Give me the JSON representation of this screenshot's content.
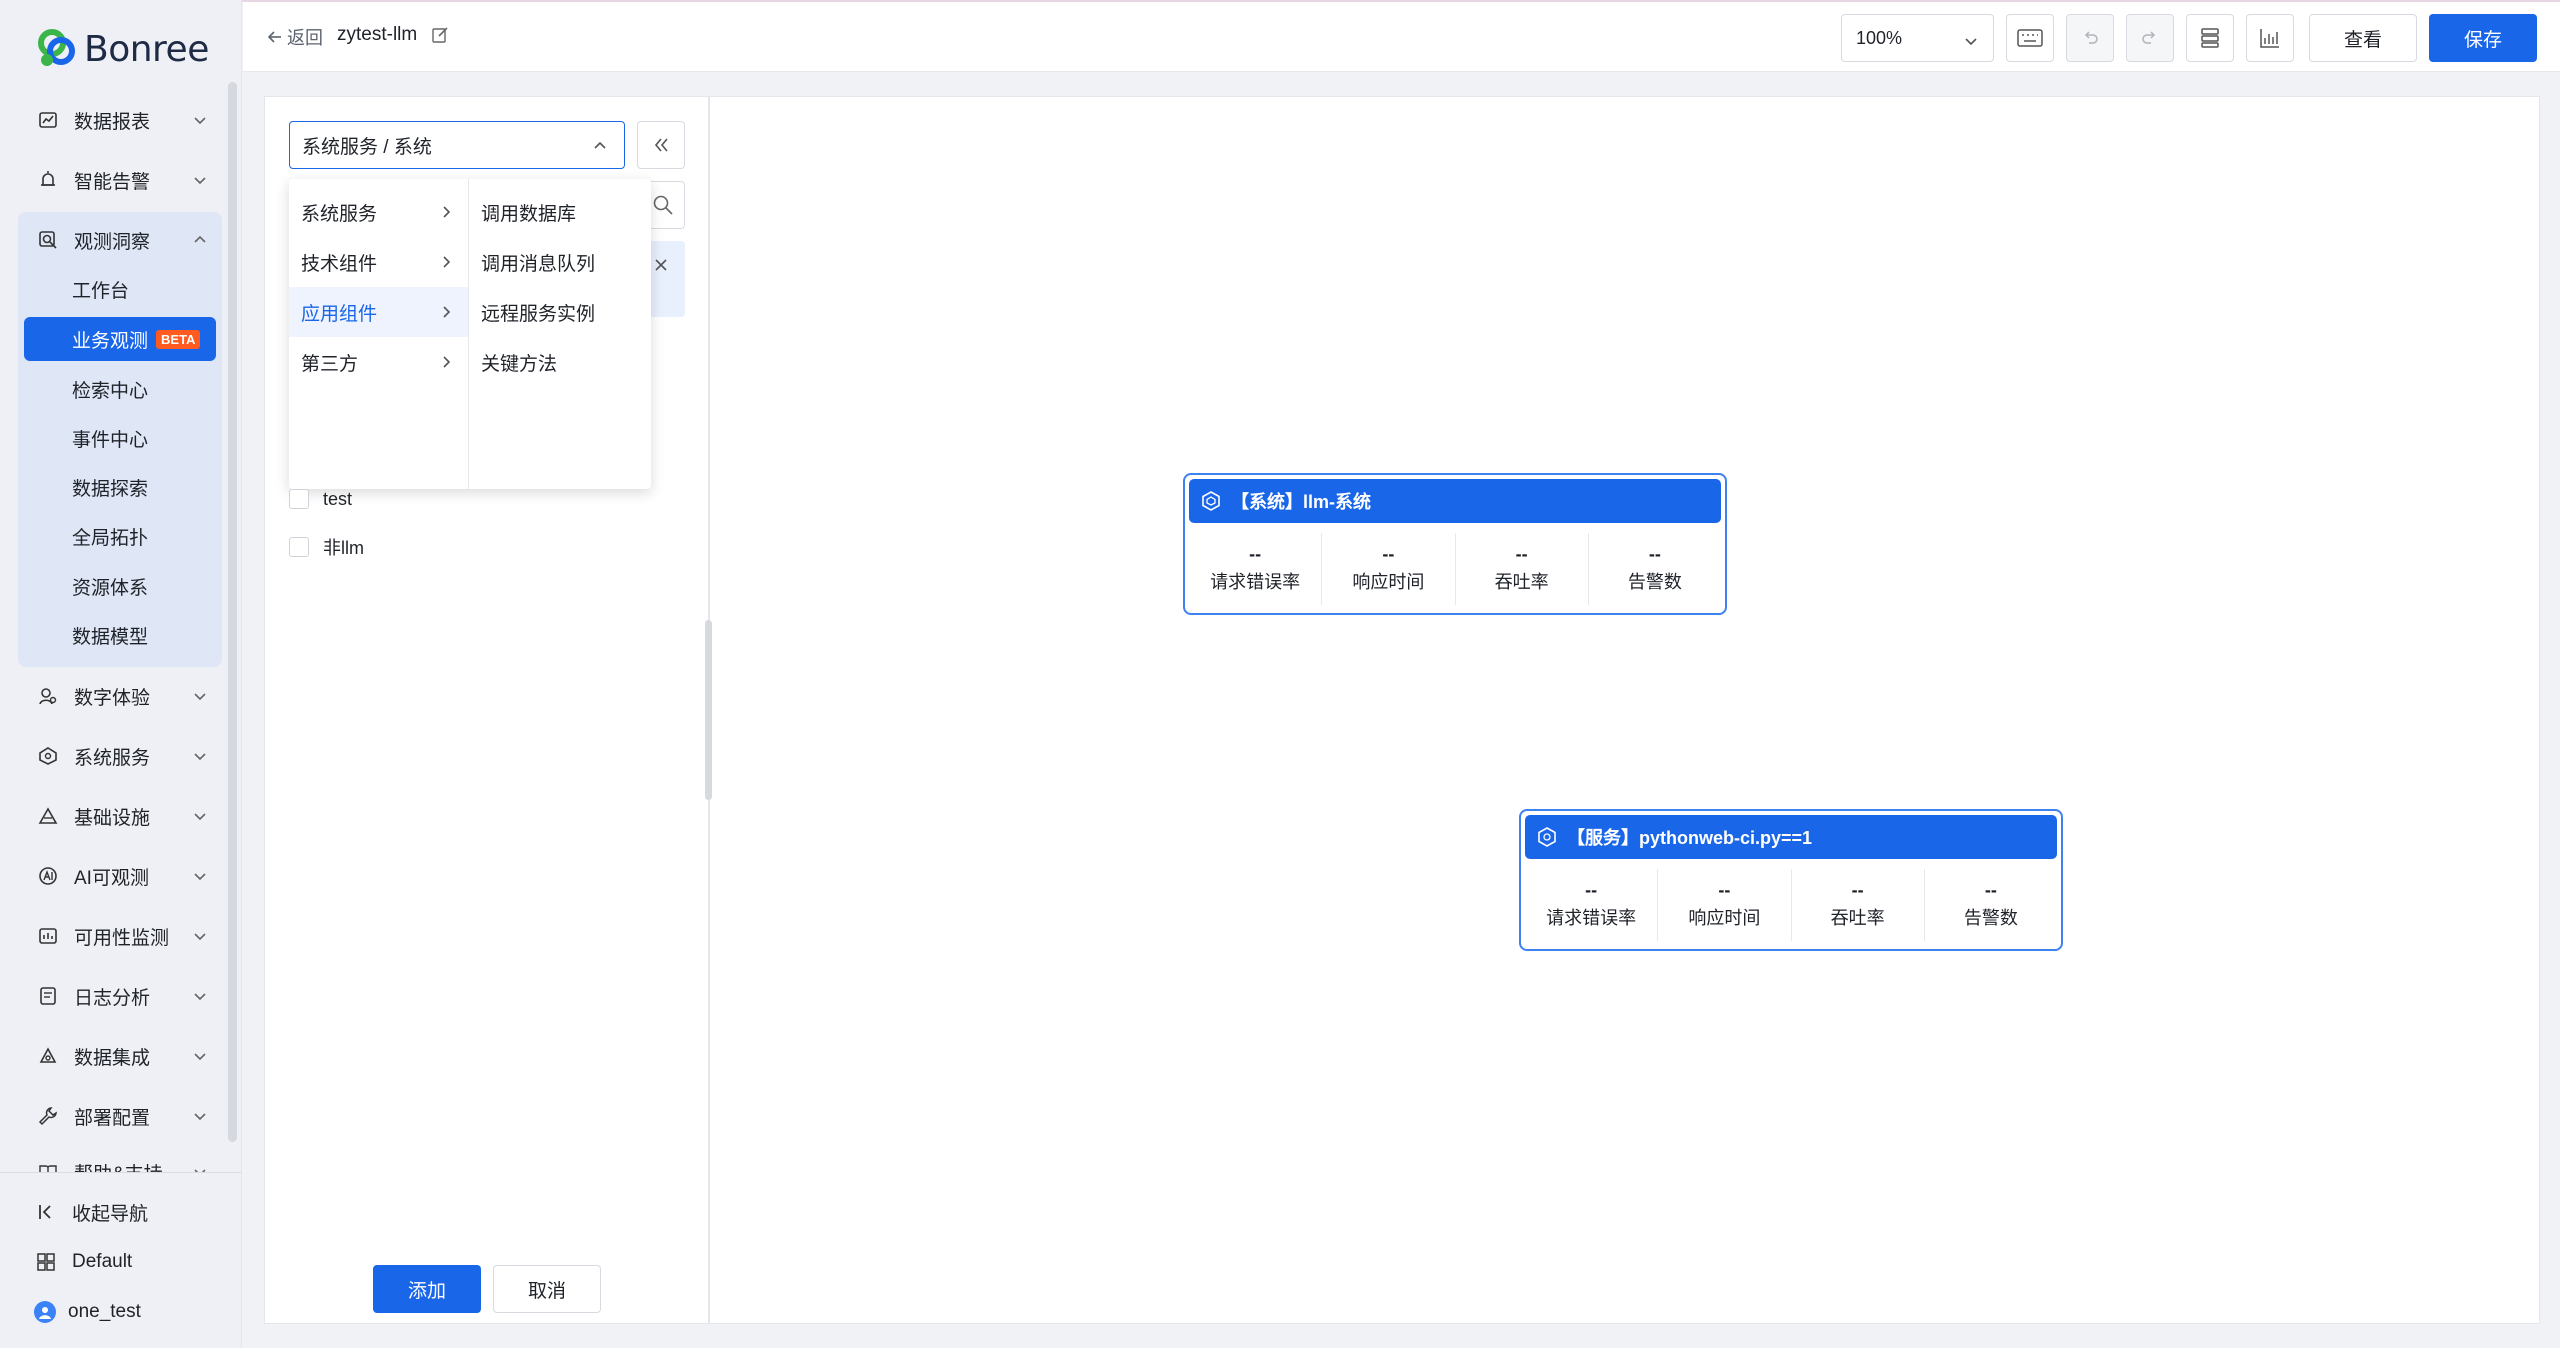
{
  "brand": {
    "logo_text": "Bonree",
    "accent": "#1a66e8",
    "beta_color": "#ff5a1f"
  },
  "sidebar": {
    "top_items": [
      {
        "label": "数据报表",
        "icon": "chart-icon"
      },
      {
        "label": "智能告警",
        "icon": "alarm-icon"
      },
      {
        "label": "观测洞察",
        "icon": "magnifier-icon",
        "expanded": true
      }
    ],
    "sub_items": [
      {
        "label": "工作台"
      },
      {
        "label": "业务观测",
        "badge": "BETA",
        "active": true
      },
      {
        "label": "检索中心"
      },
      {
        "label": "事件中心"
      },
      {
        "label": "数据探索"
      },
      {
        "label": "全局拓扑"
      },
      {
        "label": "资源体系"
      },
      {
        "label": "数据模型"
      }
    ],
    "rest_items": [
      {
        "label": "数字体验",
        "icon": "user-experience-icon"
      },
      {
        "label": "系统服务",
        "icon": "system-service-icon"
      },
      {
        "label": "基础设施",
        "icon": "infrastructure-icon"
      },
      {
        "label": "AI可观测",
        "icon": "ai-icon"
      },
      {
        "label": "可用性监测",
        "icon": "availability-icon"
      },
      {
        "label": "日志分析",
        "icon": "log-icon"
      },
      {
        "label": "数据集成",
        "icon": "integration-icon"
      },
      {
        "label": "部署配置",
        "icon": "wrench-icon"
      },
      {
        "label": "帮助&支持",
        "icon": "book-icon"
      }
    ],
    "bottom": {
      "collapse_label": "收起导航",
      "workspace_label": "Default",
      "user_label": "one_test"
    }
  },
  "header": {
    "back_label": "返回",
    "title": "zytest-llm",
    "zoom": "100%",
    "view_label": "查看",
    "save_label": "保存"
  },
  "panel": {
    "cascader_value": "系统服务 / 系统",
    "dropdown": {
      "level1": [
        {
          "label": "系统服务"
        },
        {
          "label": "技术组件"
        },
        {
          "label": "应用组件",
          "selected": true
        },
        {
          "label": "第三方"
        }
      ],
      "level2": [
        {
          "label": "调用数据库"
        },
        {
          "label": "调用消息队列"
        },
        {
          "label": "远程服务实例"
        },
        {
          "label": "关键方法"
        }
      ]
    },
    "checkbox_items": [
      {
        "label": "test",
        "checked": false
      },
      {
        "label": "非llm",
        "checked": false
      }
    ],
    "add_label": "添加",
    "cancel_label": "取消"
  },
  "canvas": {
    "nodes": [
      {
        "title": "【系统】llm-系统",
        "metrics": [
          {
            "value": "--",
            "label": "请求错误率"
          },
          {
            "value": "--",
            "label": "响应时间"
          },
          {
            "value": "--",
            "label": "吞吐率"
          },
          {
            "value": "--",
            "label": "告警数"
          }
        ]
      },
      {
        "title": "【服务】pythonweb-ci.py==1",
        "metrics": [
          {
            "value": "--",
            "label": "请求错误率"
          },
          {
            "value": "--",
            "label": "响应时间"
          },
          {
            "value": "--",
            "label": "吞吐率"
          },
          {
            "value": "--",
            "label": "告警数"
          }
        ]
      }
    ]
  }
}
